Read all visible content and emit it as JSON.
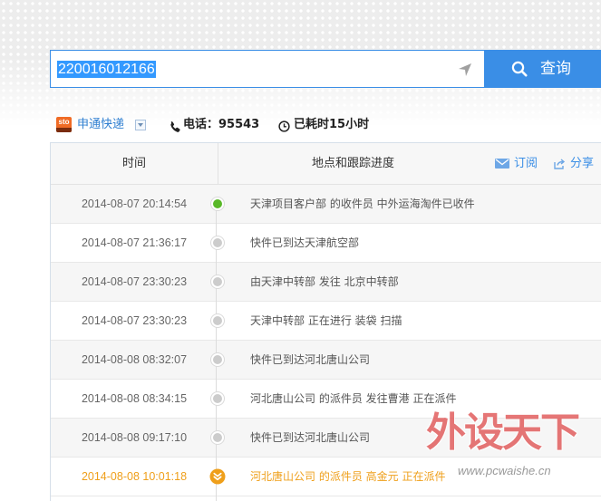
{
  "search": {
    "value": "220016012166",
    "button_label": "查询"
  },
  "carrier": {
    "logo_text": "sto",
    "name": "申通快递",
    "phone": "电话：95543",
    "elapsed": "已耗时15小时"
  },
  "table": {
    "header_time": "时间",
    "header_progress": "地点和跟踪进度",
    "subscribe_label": "订阅",
    "share_label": "分享",
    "rows": [
      {
        "time": "2014-08-07 20:14:54",
        "description": "天津项目客户部 的收件员 中外运海淘件已收件",
        "dot_icon": "collected-dot-icon"
      },
      {
        "time": "2014-08-07 21:36:17",
        "description": "快件已到达天津航空部",
        "dot_icon": "transit-dot-icon"
      },
      {
        "time": "2014-08-07 23:30:23",
        "description": "由天津中转部 发往 北京中转部",
        "dot_icon": "transit-dot-icon"
      },
      {
        "time": "2014-08-07 23:30:23",
        "description": "天津中转部 正在进行 装袋 扫描",
        "dot_icon": "transit-dot-icon"
      },
      {
        "time": "2014-08-08 08:32:07",
        "description": "快件已到达河北唐山公司",
        "dot_icon": "transit-dot-icon"
      },
      {
        "time": "2014-08-08 08:34:15",
        "description": "河北唐山公司 的派件员 发往曹港 正在派件",
        "dot_icon": "transit-dot-icon"
      },
      {
        "time": "2014-08-08 09:17:10",
        "description": "快件已到达河北唐山公司",
        "dot_icon": "transit-dot-icon"
      },
      {
        "time": "2014-08-08 10:01:18",
        "description": "河北唐山公司 的派件员 高金元 正在派件",
        "dot_icon": "delivering-dot-icon"
      }
    ]
  },
  "watermark": {
    "title": "外设天下",
    "url": "www.pcwaishe.cn"
  },
  "icons": {
    "locate": "location-arrow-icon",
    "search": "search-icon",
    "carrier_logo": "sto-logo-icon",
    "dropdown": "dropdown-icon",
    "phone": "phone-icon",
    "elapsed": "clock-icon",
    "subscribe": "envelope-icon",
    "share": "share-icon"
  },
  "colors": {
    "accent": "#3a8ee6",
    "link": "#2f7fd1",
    "collected": "#58b828",
    "latest": "#ef9f1a",
    "selection": "#3399ff"
  }
}
